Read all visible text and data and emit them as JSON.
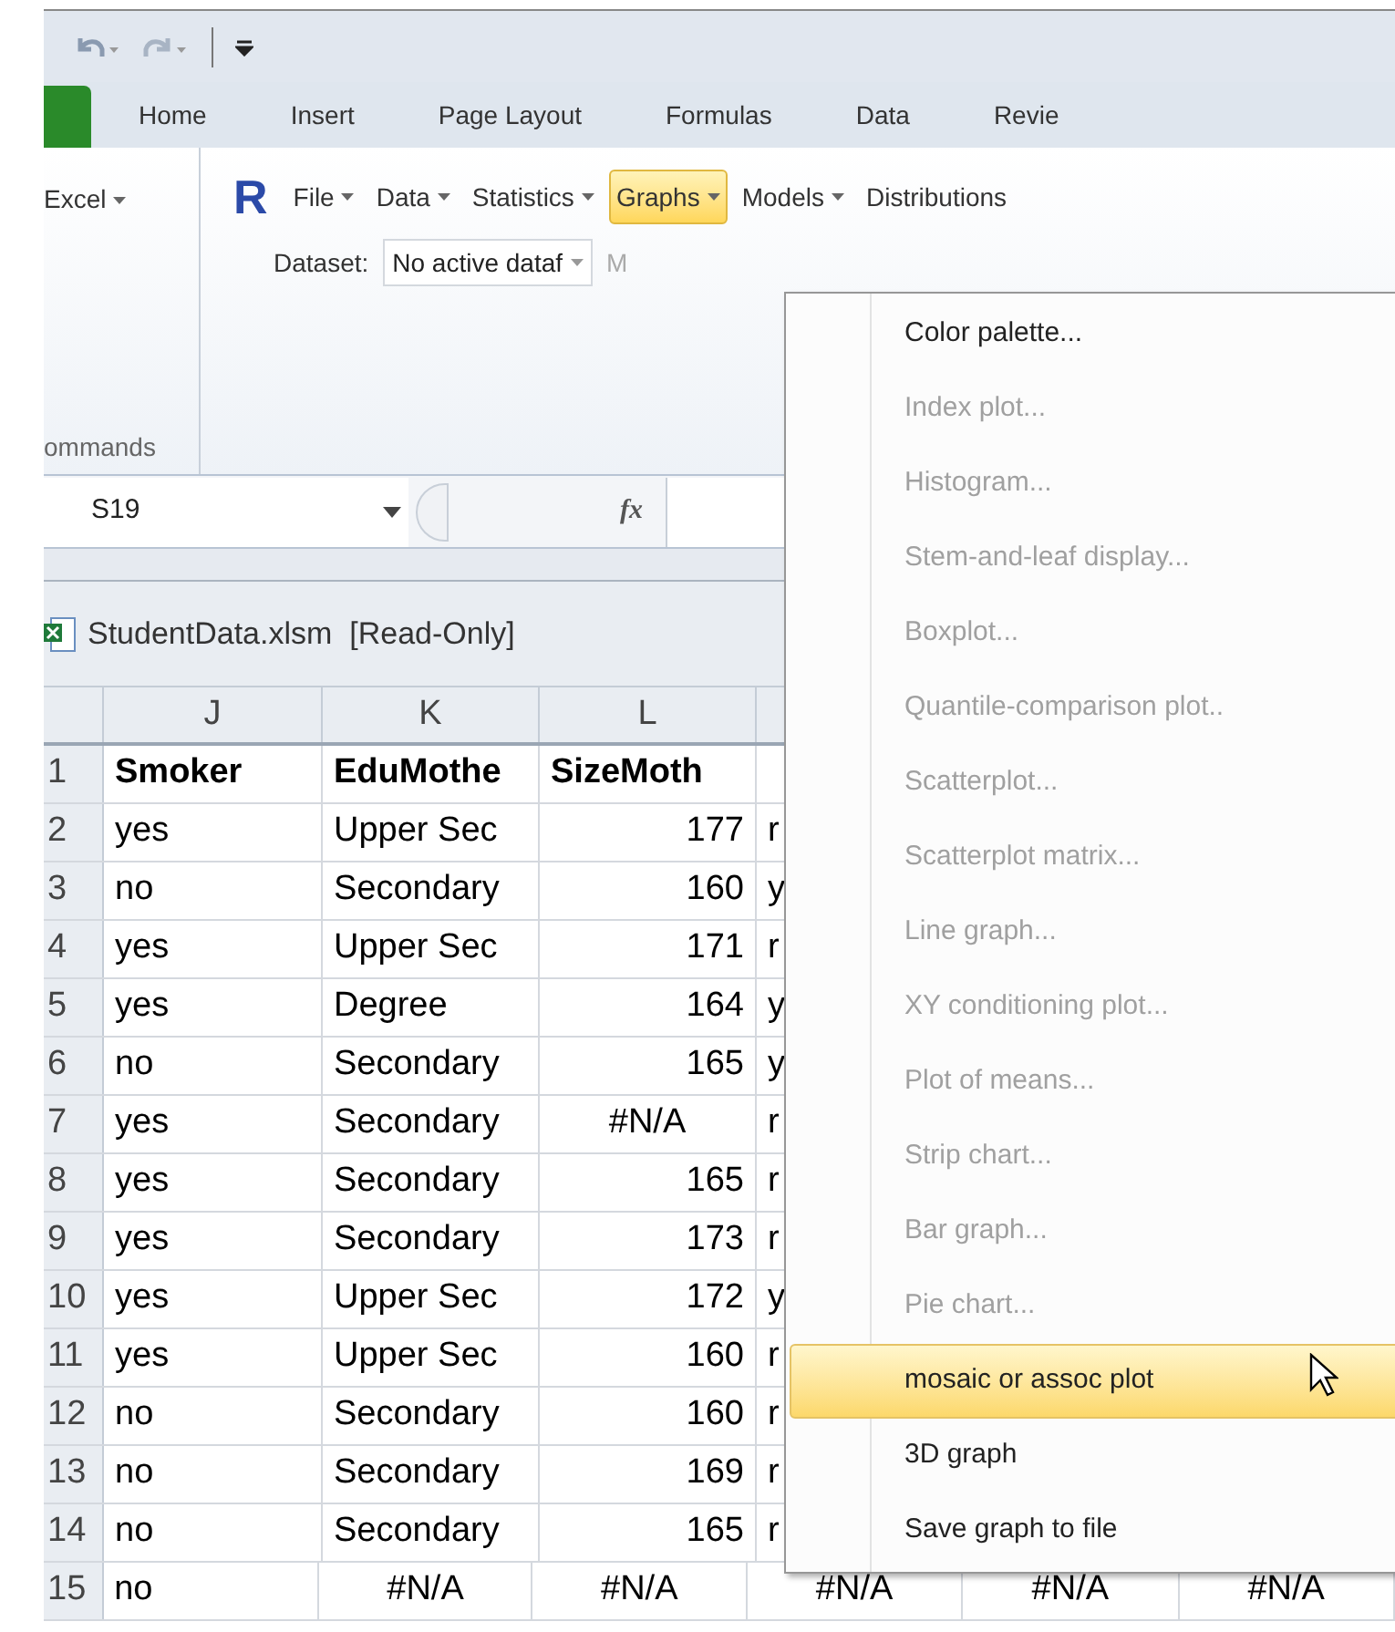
{
  "ribbon_tabs": [
    {
      "label": "Home",
      "selected": false
    },
    {
      "label": "Insert",
      "selected": false
    },
    {
      "label": "Page Layout",
      "selected": false
    },
    {
      "label": "Formulas",
      "selected": false
    },
    {
      "label": "Data",
      "selected": false
    },
    {
      "label": "Revie",
      "selected": false
    }
  ],
  "addin_toolbar": {
    "left_label": "Excel",
    "logo": "R",
    "menus": [
      {
        "label": "File",
        "selected": false
      },
      {
        "label": "Data",
        "selected": false
      },
      {
        "label": "Statistics",
        "selected": false
      },
      {
        "label": "Graphs",
        "selected": true
      },
      {
        "label": "Models",
        "selected": false
      },
      {
        "label": "Distributions",
        "selected": false
      }
    ]
  },
  "dataset": {
    "label": "Dataset:",
    "value": "No active dataf",
    "next_label": "M"
  },
  "group_label": "ommands",
  "name_box": "S19",
  "function_label": "fx",
  "workbook_title": "StudentData.xlsm  [Read-Only]",
  "columns": [
    "J",
    "K",
    "L"
  ],
  "rows": [
    {
      "number": "1",
      "bold": true,
      "cells": [
        {
          "text": "Smoker",
          "kind": "text"
        },
        {
          "text": "EduMothe",
          "kind": "text"
        },
        {
          "text": "SizeMoth",
          "kind": "text"
        }
      ]
    },
    {
      "number": "2",
      "bold": false,
      "cells": [
        {
          "text": "yes",
          "kind": "text"
        },
        {
          "text": "Upper Sec",
          "kind": "text"
        },
        {
          "text": "177",
          "kind": "number"
        },
        {
          "text": "r",
          "kind": "text"
        }
      ]
    },
    {
      "number": "3",
      "bold": false,
      "cells": [
        {
          "text": "no",
          "kind": "text"
        },
        {
          "text": "Secondary",
          "kind": "text"
        },
        {
          "text": "160",
          "kind": "number"
        },
        {
          "text": "y",
          "kind": "text"
        }
      ]
    },
    {
      "number": "4",
      "bold": false,
      "cells": [
        {
          "text": "yes",
          "kind": "text"
        },
        {
          "text": "Upper Sec",
          "kind": "text"
        },
        {
          "text": "171",
          "kind": "number"
        },
        {
          "text": "r",
          "kind": "text"
        }
      ]
    },
    {
      "number": "5",
      "bold": false,
      "cells": [
        {
          "text": "yes",
          "kind": "text"
        },
        {
          "text": "Degree",
          "kind": "text"
        },
        {
          "text": "164",
          "kind": "number"
        },
        {
          "text": "y",
          "kind": "text"
        }
      ]
    },
    {
      "number": "6",
      "bold": false,
      "cells": [
        {
          "text": "no",
          "kind": "text"
        },
        {
          "text": "Secondary",
          "kind": "text"
        },
        {
          "text": "165",
          "kind": "number"
        },
        {
          "text": "y",
          "kind": "text"
        }
      ]
    },
    {
      "number": "7",
      "bold": false,
      "cells": [
        {
          "text": "yes",
          "kind": "text"
        },
        {
          "text": "Secondary",
          "kind": "text"
        },
        {
          "text": "#N/A",
          "kind": "error"
        },
        {
          "text": "r",
          "kind": "text"
        }
      ]
    },
    {
      "number": "8",
      "bold": false,
      "cells": [
        {
          "text": "yes",
          "kind": "text"
        },
        {
          "text": "Secondary",
          "kind": "text"
        },
        {
          "text": "165",
          "kind": "number"
        },
        {
          "text": "r",
          "kind": "text"
        }
      ]
    },
    {
      "number": "9",
      "bold": false,
      "cells": [
        {
          "text": "yes",
          "kind": "text"
        },
        {
          "text": "Secondary",
          "kind": "text"
        },
        {
          "text": "173",
          "kind": "number"
        },
        {
          "text": "r",
          "kind": "text"
        }
      ]
    },
    {
      "number": "10",
      "bold": false,
      "cells": [
        {
          "text": "yes",
          "kind": "text"
        },
        {
          "text": "Upper Sec",
          "kind": "text"
        },
        {
          "text": "172",
          "kind": "number"
        },
        {
          "text": "y",
          "kind": "text"
        }
      ]
    },
    {
      "number": "11",
      "bold": false,
      "cells": [
        {
          "text": "yes",
          "kind": "text"
        },
        {
          "text": "Upper Sec",
          "kind": "text"
        },
        {
          "text": "160",
          "kind": "number"
        },
        {
          "text": "r",
          "kind": "text"
        }
      ]
    },
    {
      "number": "12",
      "bold": false,
      "cells": [
        {
          "text": "no",
          "kind": "text"
        },
        {
          "text": "Secondary",
          "kind": "text"
        },
        {
          "text": "160",
          "kind": "number"
        },
        {
          "text": "r",
          "kind": "text"
        }
      ]
    },
    {
      "number": "13",
      "bold": false,
      "cells": [
        {
          "text": "no",
          "kind": "text"
        },
        {
          "text": "Secondary",
          "kind": "text"
        },
        {
          "text": "169",
          "kind": "number"
        },
        {
          "text": "r",
          "kind": "text"
        }
      ]
    },
    {
      "number": "14",
      "bold": false,
      "cells": [
        {
          "text": "no",
          "kind": "text"
        },
        {
          "text": "Secondary",
          "kind": "text"
        },
        {
          "text": "165",
          "kind": "number"
        },
        {
          "text": "r",
          "kind": "text"
        }
      ]
    },
    {
      "number": "15",
      "bold": false,
      "cells": [
        {
          "text": "no",
          "kind": "text"
        },
        {
          "text": "#N/A",
          "kind": "error"
        },
        {
          "text": "#N/A",
          "kind": "error"
        },
        {
          "text": "#N/A",
          "kind": "error"
        },
        {
          "text": "#N/A",
          "kind": "error"
        },
        {
          "text": "#N/A",
          "kind": "error"
        }
      ]
    }
  ],
  "graphs_menu": {
    "items": [
      {
        "label": "Color palette...",
        "disabled": false,
        "selected": false
      },
      {
        "label": "Index plot...",
        "disabled": true,
        "selected": false
      },
      {
        "label": "Histogram...",
        "disabled": true,
        "selected": false
      },
      {
        "label": "Stem-and-leaf display...",
        "disabled": true,
        "selected": false
      },
      {
        "label": "Boxplot...",
        "disabled": true,
        "selected": false
      },
      {
        "label": "Quantile-comparison plot..",
        "disabled": true,
        "selected": false
      },
      {
        "label": "Scatterplot...",
        "disabled": true,
        "selected": false
      },
      {
        "label": "Scatterplot matrix...",
        "disabled": true,
        "selected": false
      },
      {
        "label": "Line graph...",
        "disabled": true,
        "selected": false
      },
      {
        "label": "XY conditioning plot...",
        "disabled": true,
        "selected": false
      },
      {
        "label": "Plot of means...",
        "disabled": true,
        "selected": false
      },
      {
        "label": "Strip chart...",
        "disabled": true,
        "selected": false
      },
      {
        "label": "Bar graph...",
        "disabled": true,
        "selected": false
      },
      {
        "label": "Pie chart...",
        "disabled": true,
        "selected": false
      },
      {
        "label": "mosaic or assoc plot",
        "disabled": false,
        "selected": true
      },
      {
        "label": "3D graph",
        "disabled": false,
        "selected": false
      },
      {
        "label": "Save graph to file",
        "disabled": false,
        "selected": false
      }
    ]
  }
}
